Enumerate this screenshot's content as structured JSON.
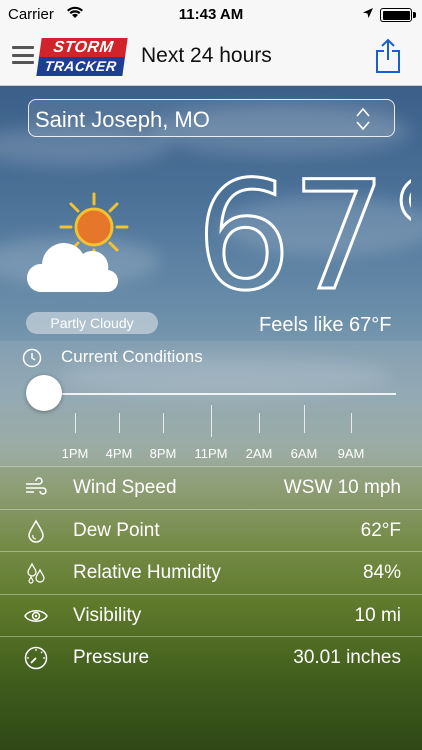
{
  "status_bar": {
    "carrier": "Carrier",
    "time": "11:43 AM"
  },
  "nav": {
    "logo_top": "STORM",
    "logo_bottom": "TRACKER",
    "title": "Next 24 hours"
  },
  "location": {
    "selected": "Saint Joseph, MO"
  },
  "current": {
    "temperature": "67°",
    "condition": "Partly Cloudy",
    "feels_like_label": "Feels like",
    "feels_like_value": "67°F"
  },
  "timeline": {
    "title": "Current Conditions",
    "labels": [
      "1PM",
      "4PM",
      "8PM",
      "11PM",
      "2AM",
      "6AM",
      "9AM"
    ]
  },
  "details": [
    {
      "icon": "wind-icon",
      "name": "Wind Speed",
      "value": "WSW 10 mph"
    },
    {
      "icon": "droplet-icon",
      "name": "Dew Point",
      "value": "62°F"
    },
    {
      "icon": "humidity-icon",
      "name": "Relative Humidity",
      "value": "84%"
    },
    {
      "icon": "eye-icon",
      "name": "Visibility",
      "value": "10 mi"
    },
    {
      "icon": "pressure-icon",
      "name": "Pressure",
      "value": "30.01 inches"
    }
  ],
  "colors": {
    "logo_red": "#d1242a",
    "logo_blue": "#1d3f8f",
    "share_blue": "#1a5fd0",
    "sun_orange": "#e5762a",
    "sun_yellow": "#f2c230"
  }
}
